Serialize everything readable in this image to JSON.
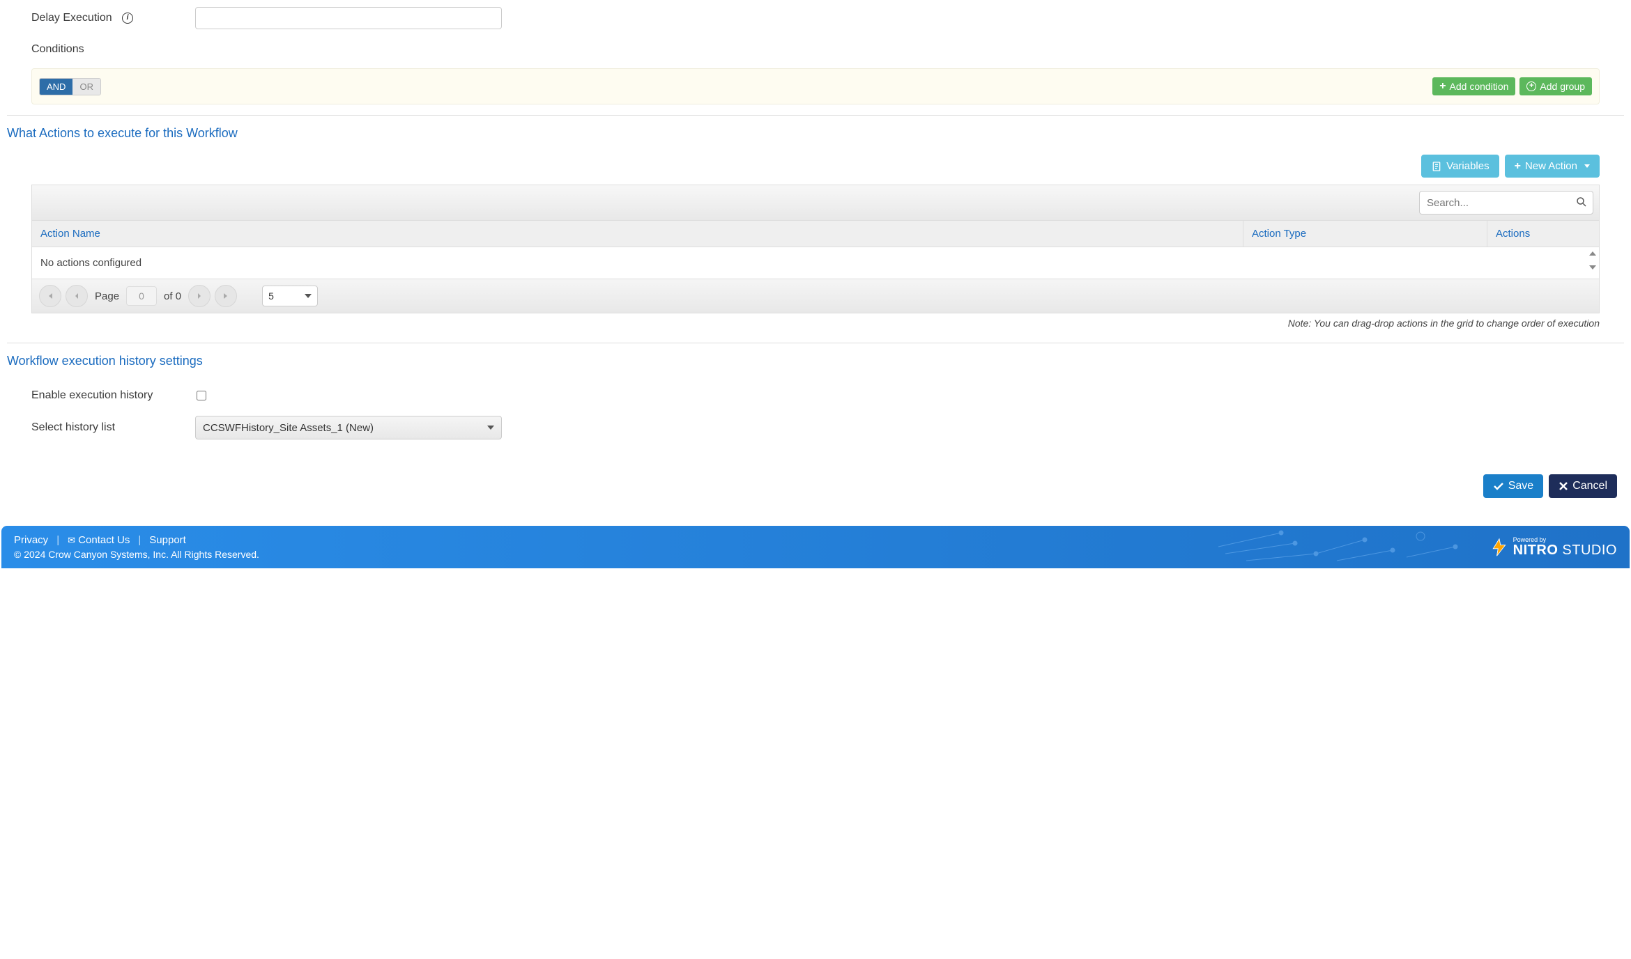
{
  "delay": {
    "label": "Delay Execution",
    "value": ""
  },
  "conditions": {
    "label": "Conditions",
    "and": "AND",
    "or": "OR",
    "add_condition": "Add condition",
    "add_group": "Add group"
  },
  "actions_section": {
    "title": "What Actions to execute for this Workflow",
    "variables_btn": "Variables",
    "new_action_btn": "New Action",
    "search_placeholder": "Search...",
    "col_name": "Action Name",
    "col_type": "Action Type",
    "col_actions": "Actions",
    "empty_text": "No actions configured",
    "page_label": "Page",
    "page_current": "0",
    "of_label": "of 0",
    "page_size": "5",
    "note": "Note: You can drag-drop actions in the grid to change order of execution"
  },
  "history": {
    "title": "Workflow execution history settings",
    "enable_label": "Enable execution history",
    "enable_checked": false,
    "select_label": "Select history list",
    "select_value": "CCSWFHistory_Site Assets_1 (New)"
  },
  "buttons": {
    "save": "Save",
    "cancel": "Cancel"
  },
  "footer": {
    "privacy": "Privacy",
    "contact": "Contact Us",
    "support": "Support",
    "copyright": "© 2024 Crow Canyon Systems, Inc. All Rights Reserved.",
    "powered_by": "Powered by",
    "brand_bold": "NITRO",
    "brand_light": " STUDIO"
  }
}
